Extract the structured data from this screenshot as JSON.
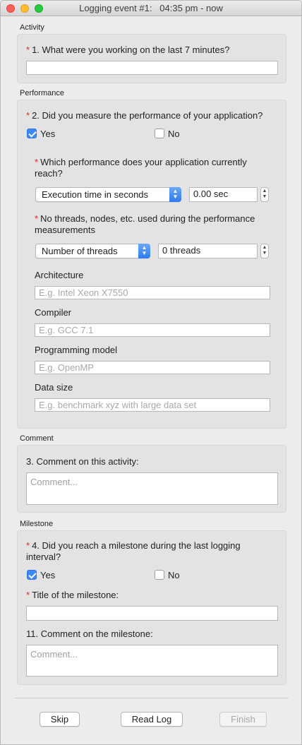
{
  "window": {
    "title": "Logging event #1:   04:35 pm - now"
  },
  "activity": {
    "section": "Activity",
    "question_num": "1. What were you working on the last 7 minutes?",
    "answer": ""
  },
  "performance": {
    "section": "Performance",
    "question": "2. Did you measure the performance of your application?",
    "yes": "Yes",
    "no": "No",
    "yes_checked": true,
    "no_checked": false,
    "reach_question": "Which performance does your application currently reach?",
    "metric_selected": "Execution time in seconds",
    "metric_value": "0.00 sec",
    "threads_question": "No threads, nodes, etc. used during the performance measurements",
    "threads_selected": "Number of threads",
    "threads_value": "0 threads",
    "architecture_label": "Architecture",
    "architecture_placeholder": "E.g. Intel Xeon X7550",
    "compiler_label": "Compiler",
    "compiler_placeholder": "E.g. GCC 7.1",
    "model_label": "Programming model",
    "model_placeholder": "E.g. OpenMP",
    "datasize_label": "Data size",
    "datasize_placeholder": "E.g. benchmark xyz with large data set"
  },
  "comment": {
    "section": "Comment",
    "question": "3. Comment on this activity:",
    "placeholder": "Comment..."
  },
  "milestone": {
    "section": "Milestone",
    "question": "4. Did you reach a milestone during the last logging interval?",
    "yes": "Yes",
    "no": "No",
    "yes_checked": true,
    "no_checked": false,
    "title_label": "Title of the milestone:",
    "title_value": "",
    "comment_label": "11. Comment on the milestone:",
    "comment_placeholder": "Comment..."
  },
  "buttons": {
    "skip": "Skip",
    "read_log": "Read Log",
    "finish": "Finish"
  },
  "colors": {
    "required": "#e0282a",
    "accent": "#3c88f7"
  }
}
